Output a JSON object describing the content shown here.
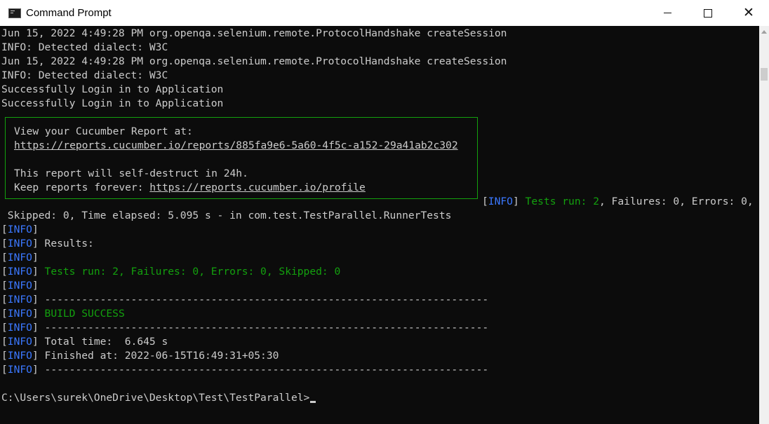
{
  "window": {
    "title": "Command Prompt",
    "close_glyph": "✕"
  },
  "console": {
    "l1": "Jun 15, 2022 4:49:28 PM org.openqa.selenium.remote.ProtocolHandshake createSession",
    "l2": "INFO: Detected dialect: W3C",
    "l3": "Jun 15, 2022 4:49:28 PM org.openqa.selenium.remote.ProtocolHandshake createSession",
    "l4": "INFO: Detected dialect: W3C",
    "l5": "Successfully Login in to Application",
    "l6": "Successfully Login in to Application",
    "report": {
      "view_text": "View your Cucumber Report at:",
      "report_url": "https://reports.cucumber.io/reports/885fa9e6-5a60-4f5c-a152-29a41ab2c302",
      "self_destruct": "This report will self-destruct in 24h.",
      "keep_prefix": "Keep reports forever: ",
      "profile_url": "https://reports.cucumber.io/profile"
    },
    "info_open": "[",
    "info_word": "INFO",
    "info_close": "]",
    "tests_run_inline": "Tests run: 2",
    "tests_inline_rest": ", Failures: 0, Errors: 0,",
    "skipped_line": " Skipped: 0, Time elapsed: 5.095 s - in com.test.TestParallel.RunnerTests",
    "results": " Results:",
    "tests_summary": " Tests run: 2, Failures: 0, Errors: 0, Skipped: 0",
    "dashes": " ------------------------------------------------------------------------",
    "build_success": " BUILD SUCCESS",
    "total_time": " Total time:  6.645 s",
    "finished_at": " Finished at: 2022-06-15T16:49:31+05:30",
    "prompt": "C:\\Users\\surek\\OneDrive\\Desktop\\Test\\TestParallel>"
  },
  "colors": {
    "info": "#3b78ff",
    "success": "#13a10e",
    "text": "#cccccc",
    "background": "#0c0c0c"
  }
}
